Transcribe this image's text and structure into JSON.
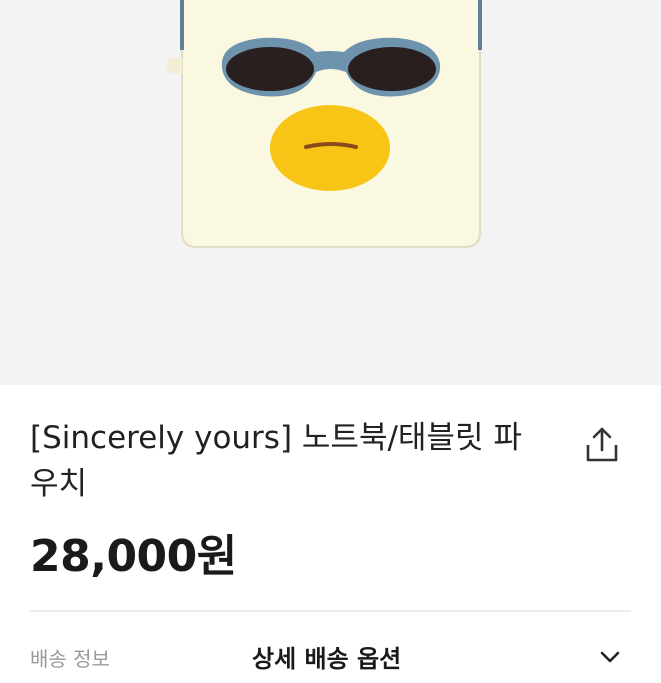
{
  "product": {
    "title": "[Sincerely yours] 노트북/태블릿 파우치",
    "price": "28,000원"
  },
  "delivery": {
    "label": "배송 정보",
    "value": "상세 배송 옵션"
  },
  "icons": {
    "share": "share-icon",
    "chevron": "chevron-down-icon"
  },
  "colors": {
    "hero_background": "#f3f3f3",
    "pouch": "#fbf8e2",
    "sunglasses_frame": "#6e93ad",
    "beak": "#f8c415"
  }
}
